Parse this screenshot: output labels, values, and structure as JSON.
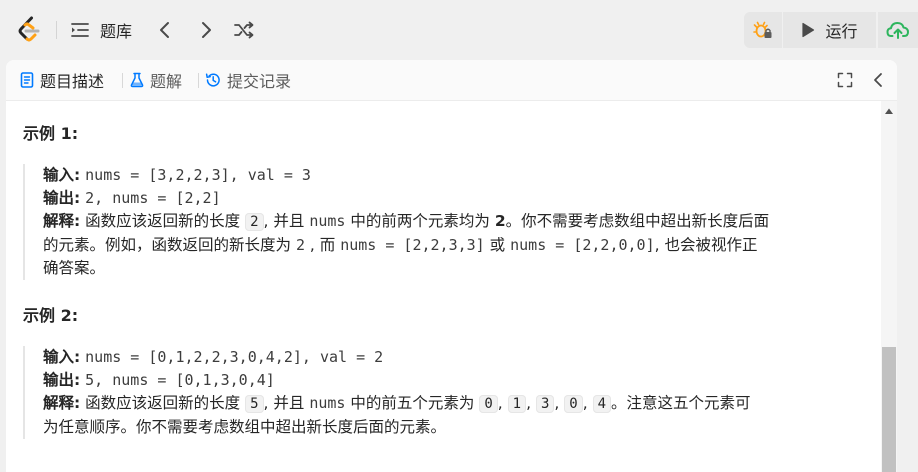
{
  "toolbar": {
    "problem_list_label": "题库",
    "run_label": "运行",
    "colors": {
      "accent_orange": "#ffa116",
      "submit_green": "#2db55d"
    }
  },
  "tabs": [
    {
      "label": "题目描述",
      "icon": "description-icon",
      "icon_color": "#007aff",
      "active": true
    },
    {
      "label": "题解",
      "icon": "flask-icon",
      "icon_color": "#007aff",
      "active": false
    },
    {
      "label": "提交记录",
      "icon": "history-icon",
      "icon_color": "#007aff",
      "active": false
    }
  ],
  "examples": [
    {
      "heading": "示例 1:",
      "input_label": "输入:",
      "input_value": "nums = [3,2,2,3], val = 3",
      "output_label": "输出:",
      "output_value": "2, nums = [2,2]",
      "explain_label": "解释:",
      "explain_p1": "函数应该返回新的长度",
      "explain_len": "2",
      "explain_p2": ", 并且",
      "explain_nums": "nums",
      "explain_p3": "中的前两个元素均为",
      "explain_val": "2",
      "explain_p4": "。你不需要考虑数组中超出新长度后面",
      "explain_line2_p1": "的元素。例如，函数返回的新长度为",
      "explain_line2_len": "2",
      "explain_line2_p2": ", 而",
      "explain_line2_ex1": "nums = [2,2,3,3]",
      "explain_line2_p3": "或",
      "explain_line2_ex2": "nums = [2,2,0,0]",
      "explain_line2_p4": ", 也会被视作正",
      "explain_line3": "确答案。"
    },
    {
      "heading": "示例 2:",
      "input_label": "输入:",
      "input_value": "nums = [0,1,2,2,3,0,4,2], val = 2",
      "output_label": "输出:",
      "output_value": "5, nums = [0,1,3,0,4]",
      "explain_label": "解释:",
      "explain_p1": "函数应该返回新的长度",
      "explain_len": "5",
      "explain_p2": ", 并且",
      "explain_nums": "nums",
      "explain_p3": "中的前五个元素为",
      "chips": [
        "0",
        "1",
        "3",
        "0",
        "4"
      ],
      "chip_sep": ",",
      "explain_p4": "。注意这五个元素可",
      "explain_line2": "为任意顺序。你不需要考虑数组中超出新长度后面的元素。"
    }
  ]
}
